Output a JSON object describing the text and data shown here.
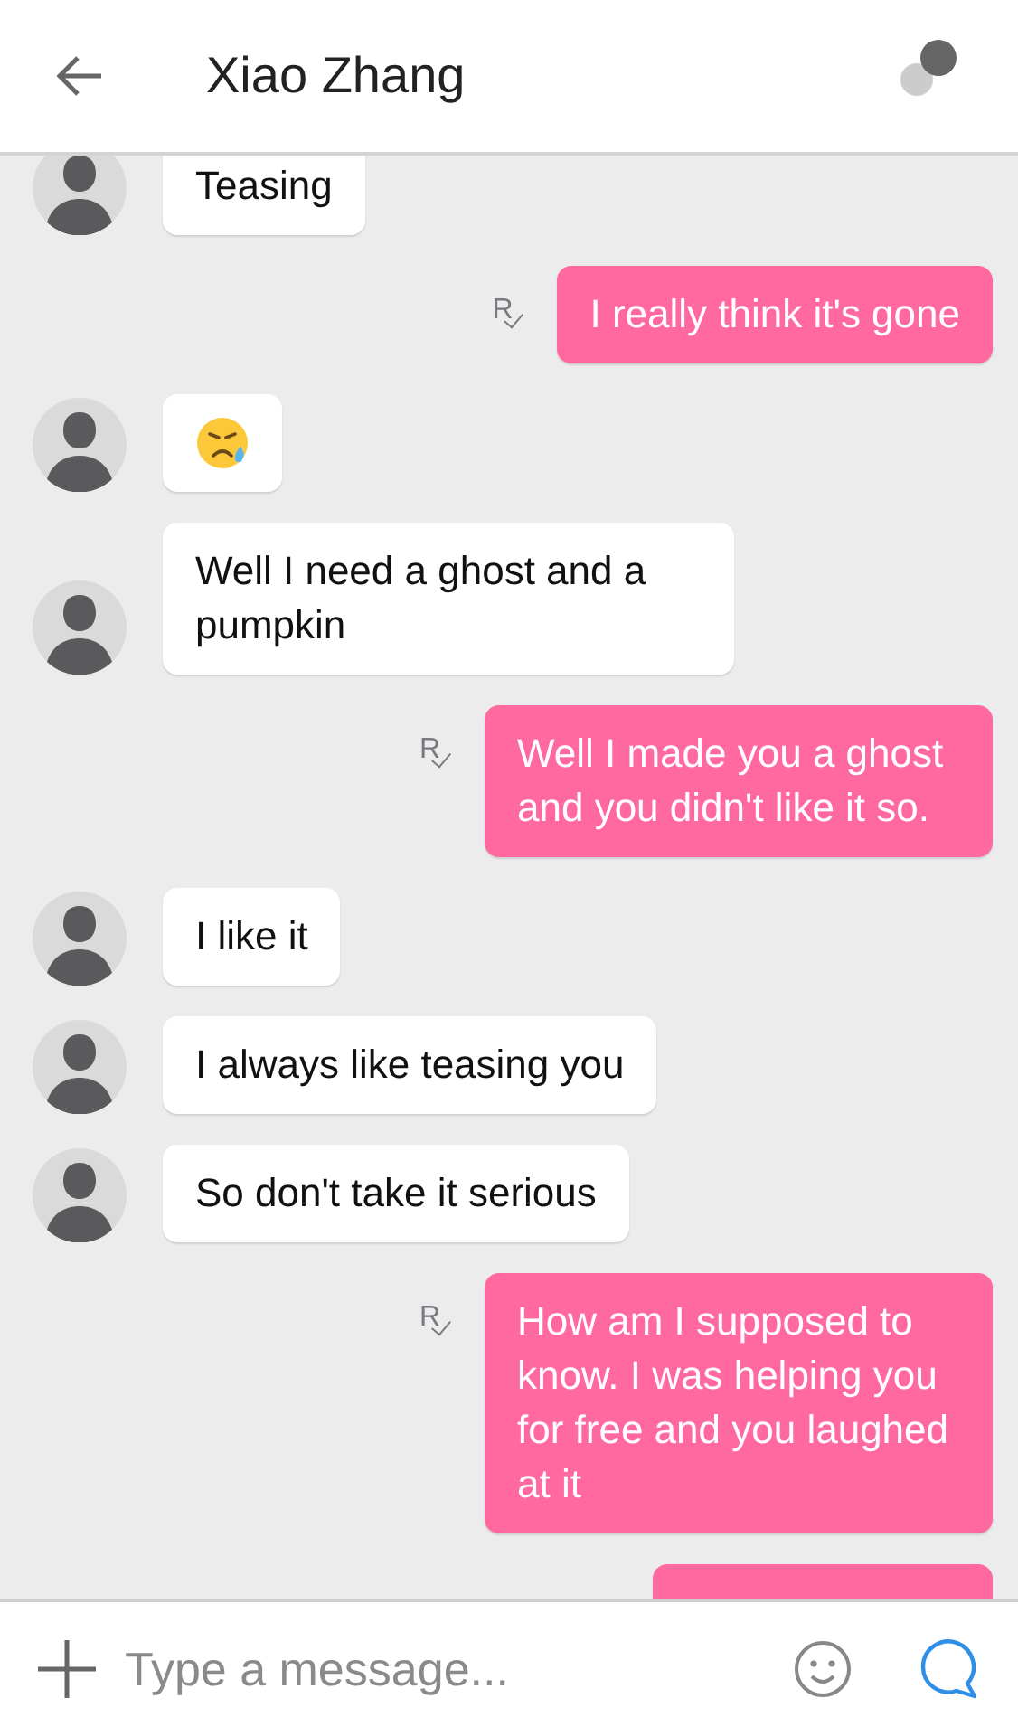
{
  "header": {
    "title": "Xiao Zhang"
  },
  "messages": [
    {
      "kind": "received",
      "text": "Teasing"
    },
    {
      "kind": "sent",
      "text": "I really think it's gone",
      "receipt": "R"
    },
    {
      "kind": "received-emoji"
    },
    {
      "kind": "received",
      "text": "Well I need a ghost and a pumpkin"
    },
    {
      "kind": "sent",
      "text": "Well I made you a ghost and you didn't like it so.",
      "receipt": "R"
    },
    {
      "kind": "received",
      "text": "I like it"
    },
    {
      "kind": "received",
      "text": "I always like teasing you"
    },
    {
      "kind": "received",
      "text": "So don't take it serious"
    },
    {
      "kind": "sent",
      "text": "How am I supposed to know. I was helping you for free and you laughed at it",
      "receipt": "R"
    },
    {
      "kind": "sent-hidden"
    }
  ],
  "composer": {
    "placeholder": "Type a message..."
  }
}
